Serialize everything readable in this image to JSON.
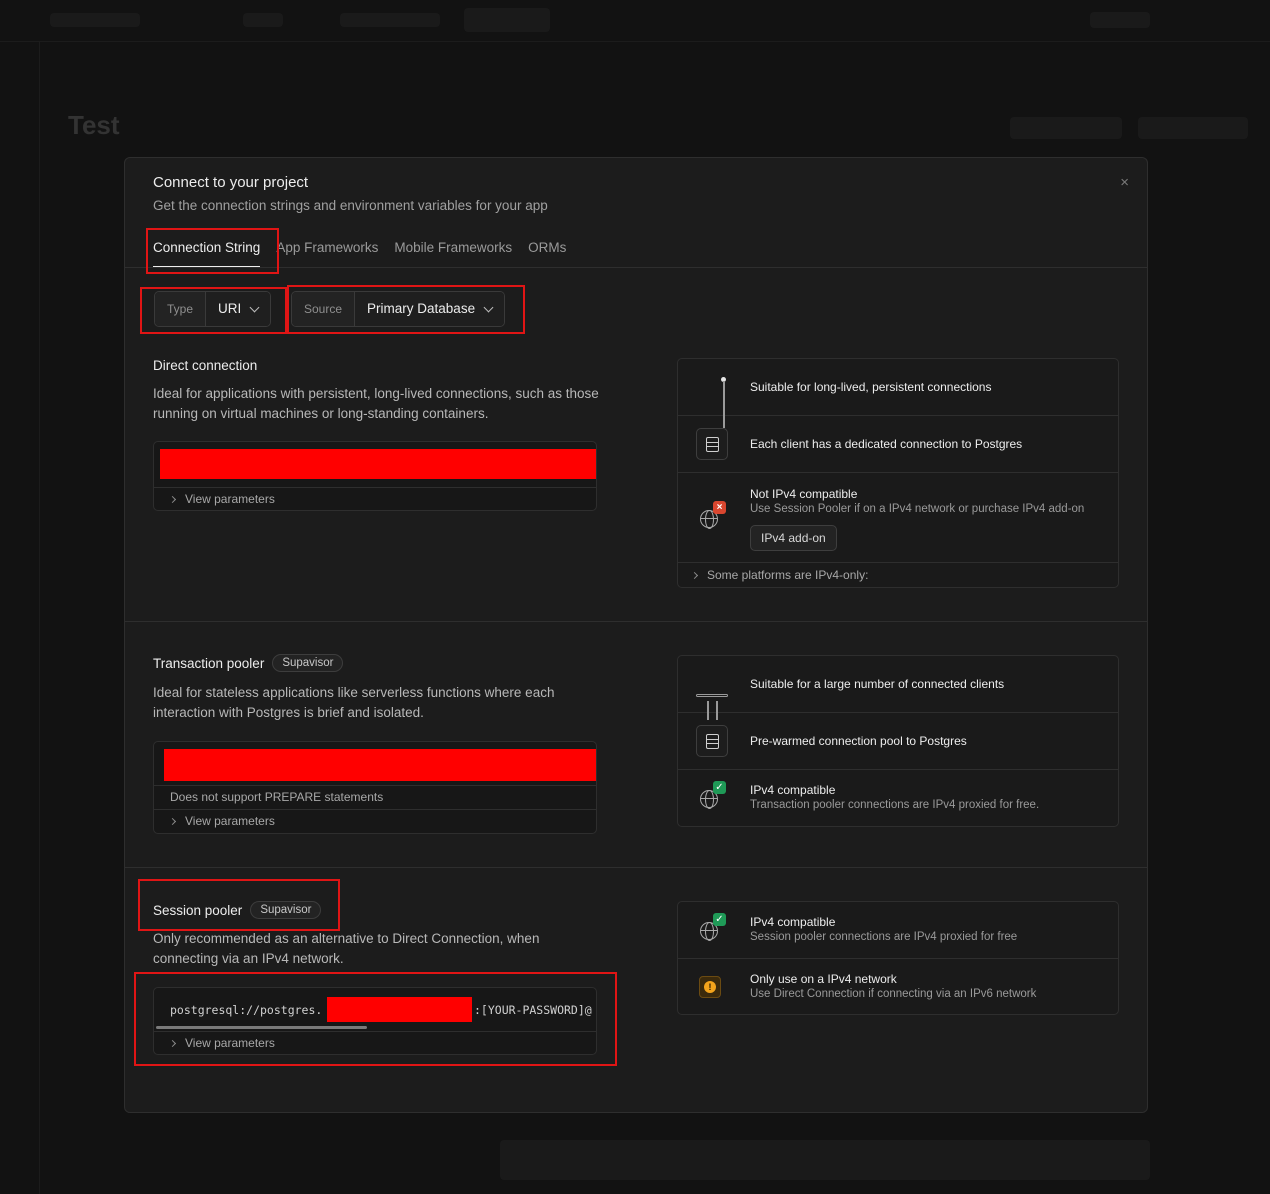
{
  "modal": {
    "title": "Connect to your project",
    "subtitle": "Get the connection strings and environment variables for your app",
    "close_icon": "×"
  },
  "tabs": [
    {
      "label": "Connection String",
      "active": true
    },
    {
      "label": "App Frameworks",
      "active": false
    },
    {
      "label": "Mobile Frameworks",
      "active": false
    },
    {
      "label": "ORMs",
      "active": false
    }
  ],
  "type_selector": {
    "label": "Type",
    "value": "URI"
  },
  "source_selector": {
    "label": "Source",
    "value": "Primary Database"
  },
  "direct": {
    "title": "Direct connection",
    "description": "Ideal for applications with persistent, long-lived connections, such as those running on virtual machines or long-standing containers.",
    "view_params": "View parameters",
    "info": {
      "row1": "Suitable for long-lived, persistent connections",
      "row2": "Each client has a dedicated connection to Postgres",
      "row3_title": "Not IPv4 compatible",
      "row3_sub": "Use Session Pooler if on a IPv4 network or purchase IPv4 add-on",
      "addon_button": "IPv4 add-on",
      "footer": "Some platforms are IPv4-only:"
    }
  },
  "transaction": {
    "title": "Transaction pooler",
    "badge": "Supavisor",
    "description": "Ideal for stateless applications like serverless functions where each interaction with Postgres is brief and isolated.",
    "note": "Does not support PREPARE statements",
    "view_params": "View parameters",
    "info": {
      "row1": "Suitable for a large number of connected clients",
      "row2": "Pre-warmed connection pool to Postgres",
      "row3_title": "IPv4 compatible",
      "row3_sub": "Transaction pooler connections are IPv4 proxied for free."
    }
  },
  "session": {
    "title": "Session pooler",
    "badge": "Supavisor",
    "description": "Only recommended as an alternative to Direct Connection, when connecting via an IPv4 network.",
    "uri_prefix": "postgresql://postgres.",
    "uri_suffix": ":[YOUR-PASSWORD]@",
    "view_params": "View parameters",
    "info": {
      "row1_title": "IPv4 compatible",
      "row1_sub": "Session pooler connections are IPv4 proxied for free",
      "row2_title": "Only use on a IPv4 network",
      "row2_sub": "Use Direct Connection if connecting via an IPv6 network"
    }
  },
  "colors": {
    "highlight": "#e01515",
    "redaction": "#ff0000",
    "success": "#1f9a57",
    "error": "#d9462f",
    "warning": "#f3a41c"
  },
  "background": {
    "page_title": "Test"
  }
}
